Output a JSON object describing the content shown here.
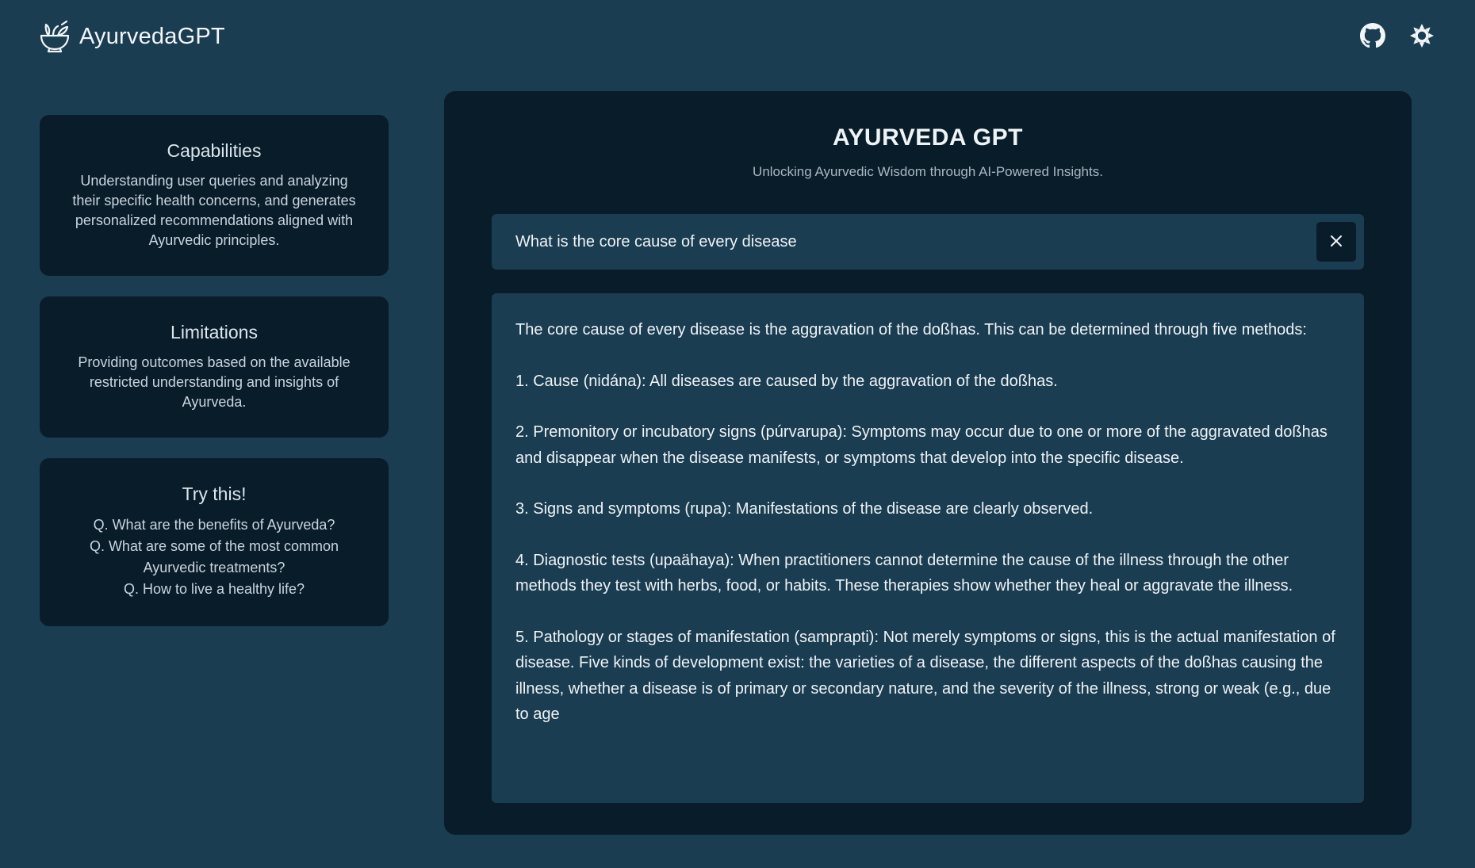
{
  "header": {
    "brand_name": "AyurvedaGPT",
    "logo_icon": "herb-bowl-icon",
    "actions": [
      {
        "icon": "github-icon"
      },
      {
        "icon": "sun-icon"
      }
    ]
  },
  "sidebar": {
    "capabilities": {
      "title": "Capabilities",
      "text": "Understanding user queries and analyzing their specific health concerns, and generates personalized recommendations aligned with Ayurvedic principles."
    },
    "limitations": {
      "title": "Limitations",
      "text": "Providing outcomes based on the available restricted understanding and insights of Ayurveda."
    },
    "try_this": {
      "title": "Try this!",
      "items": [
        "Q. What are the benefits of Ayurveda?",
        "Q. What are some of the most common Ayurvedic treatments?",
        "Q. How to live a healthy life?"
      ]
    }
  },
  "main": {
    "title": "AYURVEDA GPT",
    "subtitle": "Unlocking Ayurvedic Wisdom through AI-Powered Insights.",
    "query": {
      "value": "What is the core cause of every disease",
      "clear_icon": "close-icon"
    },
    "answer": [
      "The core cause of every disease is the aggravation of the doßhas. This can be determined through five methods:",
      "1. Cause (nidána): All diseases are caused by the aggravation of the doßhas.",
      "2. Premonitory or incubatory signs (púrvarupa): Symptoms may occur due to one or more of the aggravated doßhas and disappear when the disease manifests, or symptoms that develop into the specific disease.",
      "3. Signs and symptoms (rupa): Manifestations of the disease are clearly observed.",
      "4. Diagnostic tests (upaähaya): When practitioners cannot determine the cause of the illness through the other methods they test with herbs, food, or habits. These therapies show whether they heal or aggravate the illness.",
      "5. Pathology or stages of manifestation (samprapti): Not merely symptoms or signs, this is the actual manifestation of disease. Five kinds of development exist: the varieties of a disease, the different aspects of the doßhas causing the illness, whether a disease is of primary or secondary nature, and the severity of the illness, strong or weak (e.g., due to age"
    ]
  },
  "colors": {
    "page_bg": "#1b3d51",
    "card_bg": "#091c2a",
    "text_primary": "#eef3f6",
    "text_muted": "#a9b8c2"
  }
}
